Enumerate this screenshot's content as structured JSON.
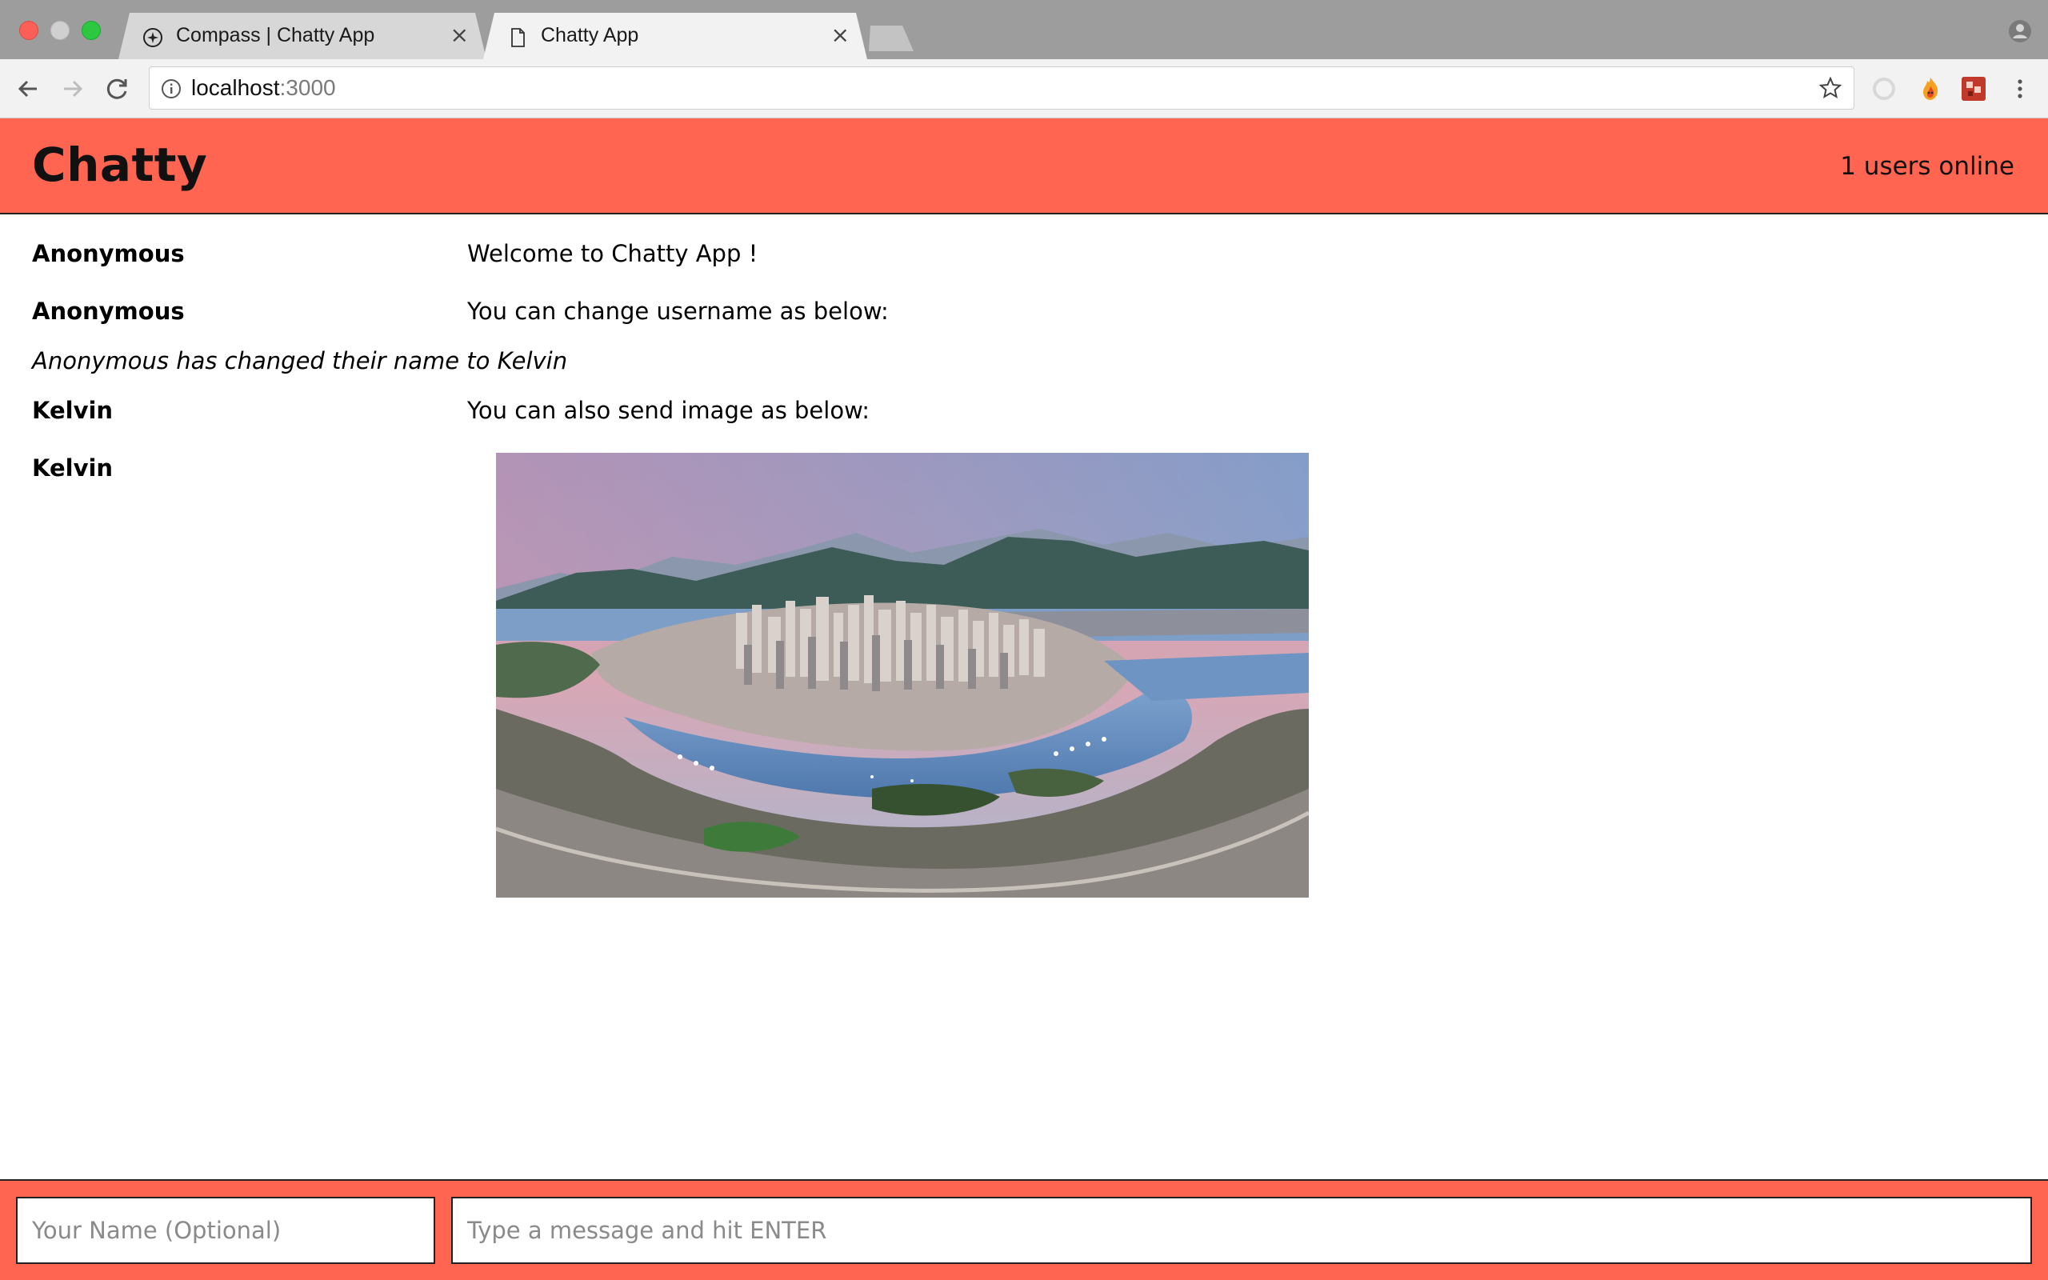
{
  "browser": {
    "tabs": [
      {
        "title": "Compass | Chatty App",
        "icon": "compass-icon",
        "active": false
      },
      {
        "title": "Chatty App",
        "icon": "page-icon",
        "active": true
      }
    ],
    "url_host": "localhost",
    "url_port": ":3000"
  },
  "app": {
    "brand": "Chatty",
    "users_online": "1 users online"
  },
  "messages": [
    {
      "type": "message",
      "username": "Anonymous",
      "content": "Welcome to Chatty App !"
    },
    {
      "type": "message",
      "username": "Anonymous",
      "content": "You can change username as below:"
    },
    {
      "type": "notification",
      "content": "Anonymous has changed their name to Kelvin"
    },
    {
      "type": "message",
      "username": "Kelvin",
      "content": "You can also send image as below:"
    },
    {
      "type": "image",
      "username": "Kelvin",
      "content": "city-skyline-photo"
    }
  ],
  "chatbar": {
    "username_placeholder": "Your Name (Optional)",
    "message_placeholder": "Type a message and hit ENTER"
  },
  "colors": {
    "accent": "#ff6551",
    "tabstrip": "#9d9d9d",
    "toolbar": "#f2f2f2"
  }
}
